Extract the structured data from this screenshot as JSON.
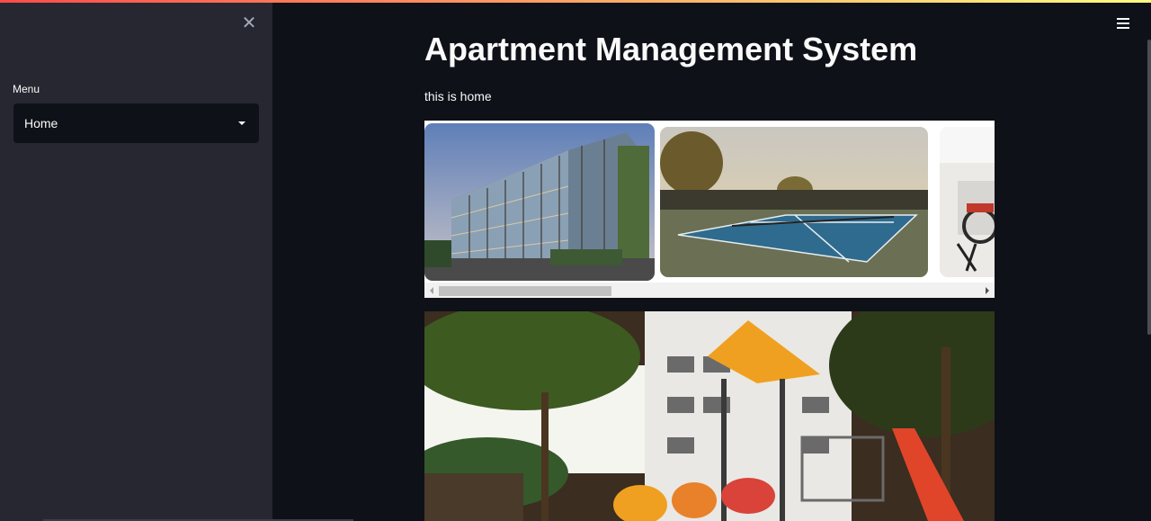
{
  "sidebar": {
    "close_icon": "close-icon",
    "menu_label": "Menu",
    "menu_selected": "Home"
  },
  "header": {
    "menu_icon": "hamburger-menu-icon"
  },
  "main": {
    "title": "Apartment Management System",
    "text": "this is home"
  },
  "colors": {
    "background": "#0e1117",
    "sidebar": "#262730",
    "accent_gradient_start": "#ff4b4b",
    "accent_gradient_end": "#fffd80"
  }
}
